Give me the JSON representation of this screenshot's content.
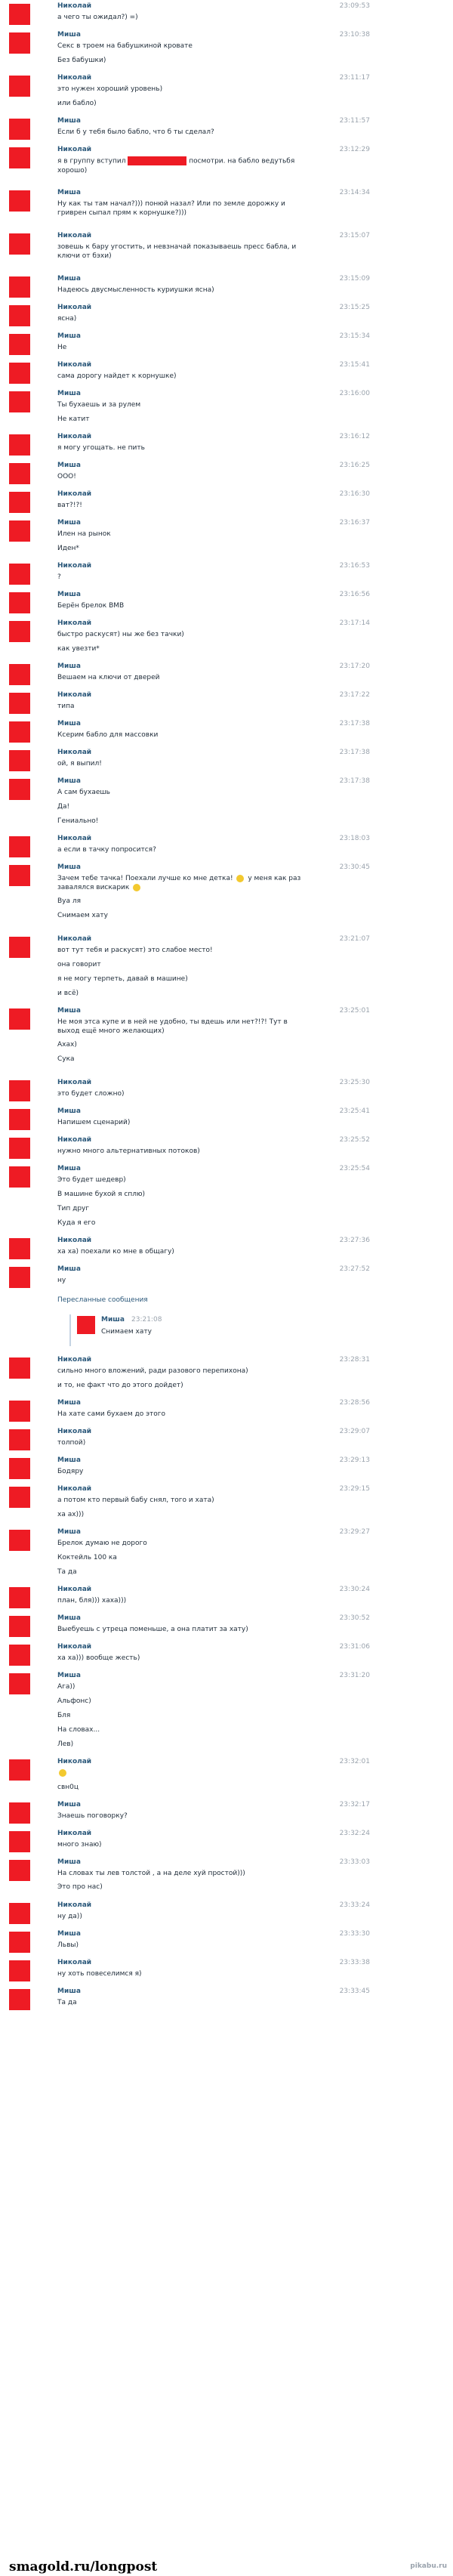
{
  "messages": [
    {
      "sender": "Николай",
      "time": "23:09:53",
      "lines": [
        "а чего ты ожидал?) =)"
      ]
    },
    {
      "sender": "Миша",
      "time": "23:10:38",
      "lines": [
        "Секс в троем на бабушкиной кровате",
        "Без бабушки)"
      ]
    },
    {
      "sender": "Николай",
      "time": "23:11:17",
      "lines": [
        "это нужен хороший уровень)",
        "или бабло)"
      ]
    },
    {
      "sender": "Миша",
      "time": "23:11:57",
      "lines": [
        "Если б у тебя было бабло, что б ты сделал?"
      ]
    },
    {
      "sender": "Николай",
      "time": "23:12:29",
      "lines": [
        "я в группу вступил [redacted] посмотри. на бабло ведутьбя хорошо)"
      ]
    },
    {
      "sender": "Миша",
      "time": "23:14:34",
      "lines": [
        "Ну как ты там начал?))) понюй назал? Или по земле дорожку и гриврен сыпал прям к корнушке?)))"
      ]
    },
    {
      "sender": "Николай",
      "time": "23:15:07",
      "lines": [
        "зовешь к бару угостить, и невзначай показываешь пресс бабла, и ключи от бэхи)"
      ]
    },
    {
      "sender": "Миша",
      "time": "23:15:09",
      "lines": [
        "Надеюсь двусмысленность куриушки ясна)"
      ]
    },
    {
      "sender": "Николай",
      "time": "23:15:25",
      "lines": [
        "ясна)"
      ]
    },
    {
      "sender": "Миша",
      "time": "23:15:34",
      "lines": [
        "Не"
      ]
    },
    {
      "sender": "Николай",
      "time": "23:15:41",
      "lines": [
        "сама дорогу найдет к корнушке)"
      ]
    },
    {
      "sender": "Миша",
      "time": "23:16:00",
      "lines": [
        "Ты бухаешь и за рулем",
        "Не катит"
      ]
    },
    {
      "sender": "Николай",
      "time": "23:16:12",
      "lines": [
        "я могу угощать. не пить"
      ]
    },
    {
      "sender": "Миша",
      "time": "23:16:25",
      "lines": [
        "ООО!"
      ]
    },
    {
      "sender": "Николай",
      "time": "23:16:30",
      "lines": [
        "ват?!?!"
      ]
    },
    {
      "sender": "Миша",
      "time": "23:16:37",
      "lines": [
        "Илен на рынок",
        "Иден*"
      ]
    },
    {
      "sender": "Николай",
      "time": "23:16:53",
      "lines": [
        "?"
      ]
    },
    {
      "sender": "Миша",
      "time": "23:16:56",
      "lines": [
        "Берён брелок BMB"
      ]
    },
    {
      "sender": "Николай",
      "time": "23:17:14",
      "lines": [
        "быстро раскусят) ны же без тачки)",
        "как увезти*"
      ]
    },
    {
      "sender": "Миша",
      "time": "23:17:20",
      "lines": [
        "Вешаем на ключи от дверей"
      ]
    },
    {
      "sender": "Николай",
      "time": "23:17:22",
      "lines": [
        "типа"
      ]
    },
    {
      "sender": "Миша",
      "time": "23:17:38",
      "lines": [
        "Ксерим бабло для массовки"
      ]
    },
    {
      "sender": "Николай",
      "time": "23:17:38",
      "lines": [
        "ой, я выпил!"
      ]
    },
    {
      "sender": "Миша",
      "time": "23:17:38",
      "lines": [
        "А сам бухаешь",
        "Да!",
        "Гениально!"
      ]
    },
    {
      "sender": "Николай",
      "time": "23:18:03",
      "lines": [
        "а если в тачку попросится?"
      ]
    },
    {
      "sender": "Миша",
      "time": "23:30:45",
      "lines": [
        "Зачем тебе тачка! Поехали лучше ко мне детка! [emoji] у меня как раз завалялся вискарик [emoji]",
        "Вуа ля",
        "Снимаем хату"
      ]
    },
    {
      "sender": "Николай",
      "time": "23:21:07",
      "lines": [
        "вот тут тебя и раскусят) это слабое место!",
        "она говорит",
        "я не могу терпеть, давай в машине)",
        "и всё)"
      ]
    },
    {
      "sender": "Миша",
      "time": "23:25:01",
      "lines": [
        "Не моя этса купе и в ней не удобно, ты вдешь или нет?!?! Тут в выход ещё много желающих)",
        "Ахах)",
        "Сука"
      ]
    },
    {
      "sender": "Николай",
      "time": "23:25:30",
      "lines": [
        "это будет сложно)"
      ]
    },
    {
      "sender": "Миша",
      "time": "23:25:41",
      "lines": [
        "Напишем сценарий)"
      ]
    },
    {
      "sender": "Николай",
      "time": "23:25:52",
      "lines": [
        "нужно много альтернативных потоков)"
      ]
    },
    {
      "sender": "Миша",
      "time": "23:25:54",
      "lines": [
        "Это будет шедевр)",
        "В машине бухой я сплю)",
        "Тип друг",
        "Куда я его"
      ]
    },
    {
      "sender": "Николай",
      "time": "23:27:36",
      "lines": [
        "ха ха) поехали ко мне в общагу)"
      ]
    },
    {
      "sender": "Миша",
      "time": "23:27:52",
      "lines": [
        "ну"
      ]
    }
  ],
  "forwarded": {
    "header": "Пересланные сообщения",
    "sender": "Миша",
    "time": "23:21:08",
    "text": "Снимаем хату"
  },
  "messages2": [
    {
      "sender": "Николай",
      "time": "23:28:31",
      "lines": [
        "сильно много вложений, ради разового перепихона)",
        "и то, не факт что до этого дойдет)"
      ]
    },
    {
      "sender": "Миша",
      "time": "23:28:56",
      "lines": [
        "На хате сами бухаем до этого"
      ]
    },
    {
      "sender": "Николай",
      "time": "23:29:07",
      "lines": [
        "толпой)"
      ]
    },
    {
      "sender": "Миша",
      "time": "23:29:13",
      "lines": [
        "Бодяру"
      ]
    },
    {
      "sender": "Николай",
      "time": "23:29:15",
      "lines": [
        "а потом кто первый бабу снял, того и хата)",
        "ха ах)))"
      ]
    },
    {
      "sender": "Миша",
      "time": "23:29:27",
      "lines": [
        "Брелок думаю не дорого",
        "Коктейль 100 ка",
        "Та да"
      ]
    },
    {
      "sender": "Николай",
      "time": "23:30:24",
      "lines": [
        "план, бля))) хаха)))"
      ]
    },
    {
      "sender": "Миша",
      "time": "23:30:52",
      "lines": [
        "Выебуешь с утреца поменьше, а она платит за хату)"
      ]
    },
    {
      "sender": "Николай",
      "time": "23:31:06",
      "lines": [
        "ха ха))) вообще жесть)"
      ]
    },
    {
      "sender": "Миша",
      "time": "23:31:20",
      "lines": [
        "Ага))",
        "Альфонс)",
        "Бля",
        "На словах...",
        "Лев)"
      ]
    },
    {
      "sender": "Николай",
      "time": "23:32:01",
      "lines": [
        "[emoji]",
        "свн0ц"
      ]
    },
    {
      "sender": "Миша",
      "time": "23:32:17",
      "lines": [
        "Знаешь поговорку?"
      ]
    },
    {
      "sender": "Николай",
      "time": "23:32:24",
      "lines": [
        "много знаю)"
      ]
    },
    {
      "sender": "Миша",
      "time": "23:33:03",
      "lines": [
        "На словах ты лев толстой , а на деле хуй простой)))",
        "Это про нас)"
      ]
    },
    {
      "sender": "Николай",
      "time": "23:33:24",
      "lines": [
        "ну да))"
      ]
    },
    {
      "sender": "Миша",
      "time": "23:33:30",
      "lines": [
        "Львы)"
      ]
    },
    {
      "sender": "Николай",
      "time": "23:33:38",
      "lines": [
        "ну хоть повеселимся я)"
      ]
    },
    {
      "sender": "Миша",
      "time": "23:33:45",
      "lines": [
        "Та да"
      ]
    }
  ],
  "footer": {
    "site": "smagold.ru/longpost",
    "logo": "pikabu.ru"
  },
  "colors": {
    "redaction": "#ee1b24",
    "sender": "#2b587a",
    "time": "#9aa3ad",
    "text": "#1e2b38"
  }
}
